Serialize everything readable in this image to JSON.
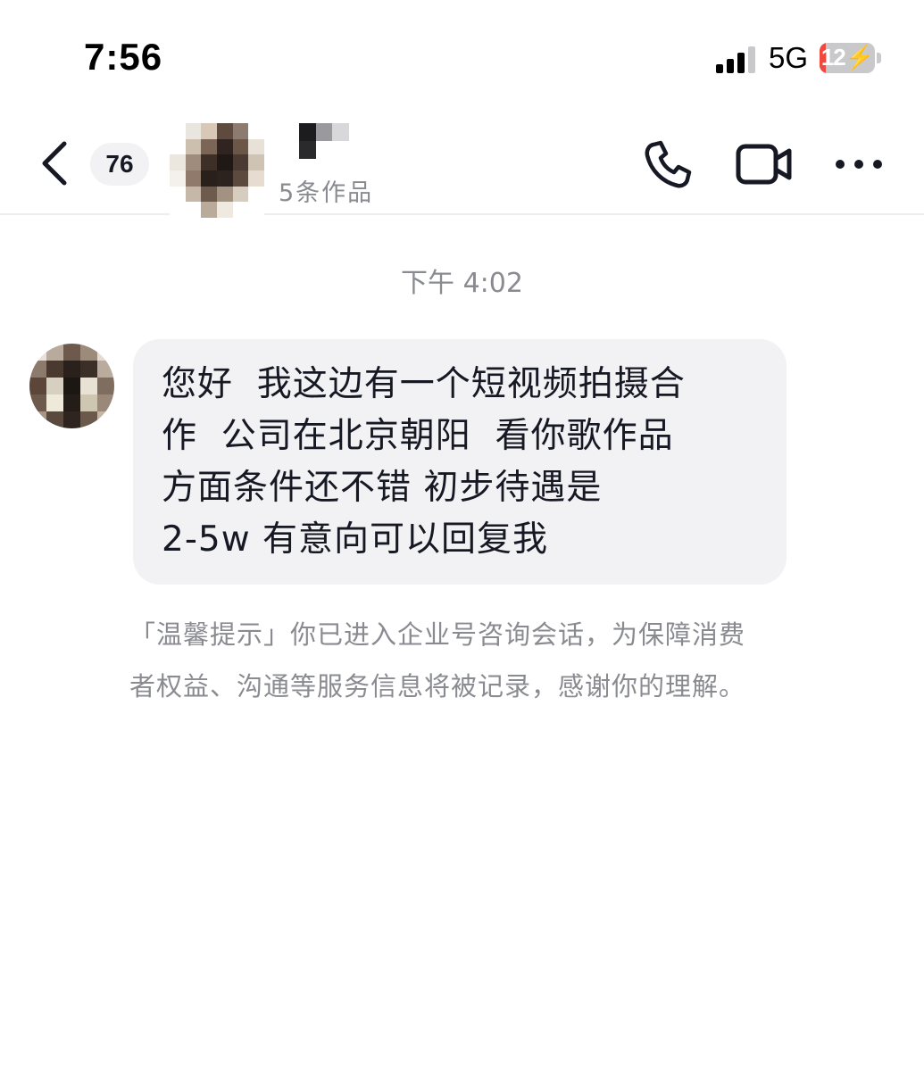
{
  "status_bar": {
    "time": "7:56",
    "network": "5G",
    "battery_level": "12",
    "battery_fraction": 0.12,
    "battery_color": "#f04a3e"
  },
  "header": {
    "unread_count": "76",
    "contact_subtitle": "5条作品",
    "icons": [
      "back-arrow-icon",
      "phone-icon",
      "video-camera-icon",
      "more-horizontal-icon"
    ]
  },
  "conversation": {
    "timestamp": "下午 4:02",
    "message": {
      "lines": [
        "您好  我这边有一个短视频拍摄合",
        "作  公司在北京朝阳  看你歌作品",
        "方面条件还不错 初步待遇是",
        "2-5w 有意向可以回复我"
      ]
    },
    "system_notice": {
      "lines": [
        "「温馨提示」你已进入企业号咨询会话，为保障消费",
        "者权益、沟通等服务信息将被记录，感谢你的理解。"
      ]
    }
  },
  "colors": {
    "bubble_background": "#f2f2f4",
    "secondary_text": "#8a8b91",
    "primary_text": "#161823"
  }
}
